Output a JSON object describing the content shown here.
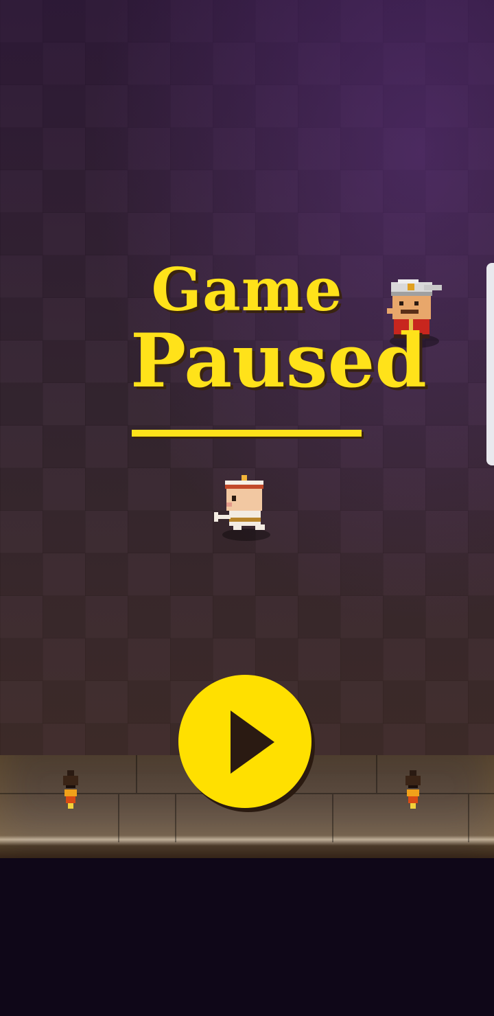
{
  "overlay": {
    "title_line1": "Game",
    "title_line2": "Paused"
  },
  "controls": {
    "resume_icon": "play-icon"
  },
  "colors": {
    "accent_yellow": "#ffe21a",
    "button_yellow": "#ffe000",
    "icon_dark": "#2a1a12",
    "floor": "#3a2a36",
    "void": "#0f0718"
  },
  "sprites": {
    "player": "player-character-icon",
    "enemy": "guard-enemy-icon",
    "torch": "wall-torch-icon"
  }
}
